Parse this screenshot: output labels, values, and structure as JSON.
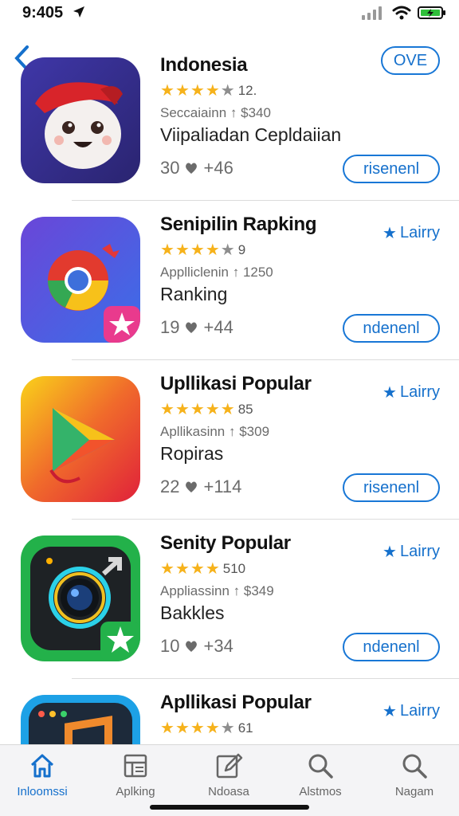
{
  "status": {
    "time": "9:405"
  },
  "apps": [
    {
      "title": "Indonesia",
      "rating_count": "12.",
      "stars": 4,
      "subtitle": "Seccaiainn ↑ $340",
      "description": "Viipaliadan Cepldaiian",
      "meta_left": "30",
      "meta_right": "+46",
      "top_label": "OVE",
      "action_label": "risenenl",
      "icon": "cartoon-face-icon"
    },
    {
      "title": "Senipilin Rapking",
      "rating_count": "9",
      "stars": 4,
      "subtitle": "Applliclenin ↑ 1250",
      "description": "Ranking",
      "meta_left": "19",
      "meta_right": "+44",
      "link_label": "Lairry",
      "action_label": "ndenenl",
      "icon": "browser-icon"
    },
    {
      "title": "Upllikasi Popular",
      "rating_count": "85",
      "stars": 5,
      "subtitle": "Apllikasinn ↑ $309",
      "description": "Ropiras",
      "meta_left": "22",
      "meta_right": "+114",
      "link_label": "Lairry",
      "action_label": "risenenl",
      "icon": "play-icon"
    },
    {
      "title": "Senity Popular",
      "rating_count": "510",
      "stars": 4,
      "subtitle": "Appliassinn ↑ $349",
      "description": "Bakkles",
      "meta_left": "10",
      "meta_right": "+34",
      "link_label": "Lairry",
      "action_label": "ndenenl",
      "icon": "camera-icon"
    },
    {
      "title": "Apllikasi Popular",
      "rating_count": "61",
      "stars": 4,
      "link_label": "Lairry",
      "icon": "music-icon"
    }
  ],
  "tabs": [
    {
      "label": "Inloomssi",
      "icon": "home-icon",
      "active": true
    },
    {
      "label": "Aplking",
      "icon": "apps-icon",
      "active": false
    },
    {
      "label": "Ndoasa",
      "icon": "edit-icon",
      "active": false
    },
    {
      "label": "Alstmos",
      "icon": "search-icon",
      "active": false
    },
    {
      "label": "Nagam",
      "icon": "search-icon",
      "active": false
    }
  ],
  "colors": {
    "accent": "#1570cc",
    "star": "#f6b21b",
    "tab_bg": "#f4f4f6"
  }
}
